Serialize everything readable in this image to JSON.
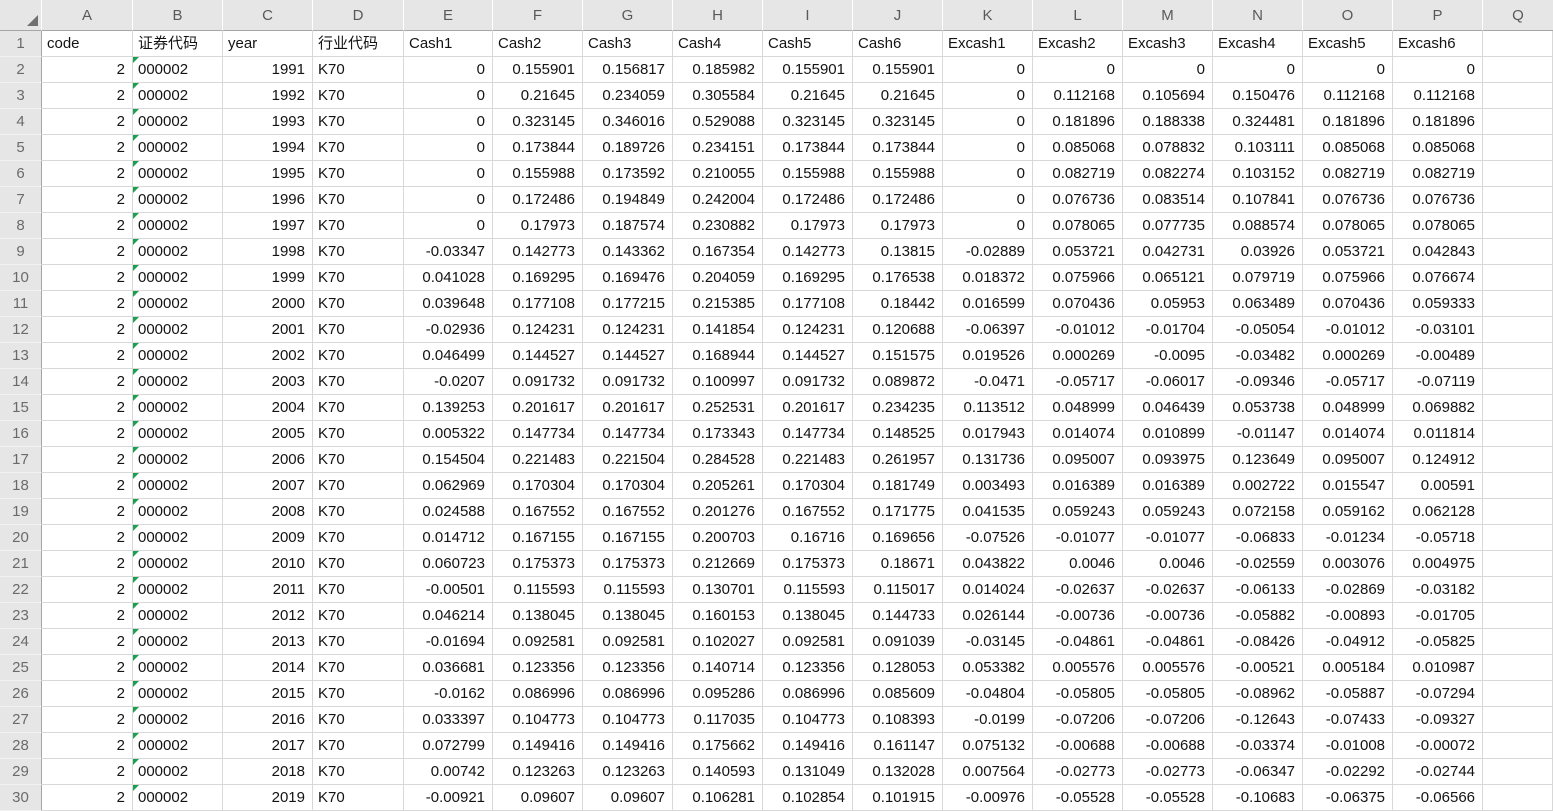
{
  "spreadsheet": {
    "corner_label": "select-all",
    "column_letters": [
      "A",
      "B",
      "C",
      "D",
      "E",
      "F",
      "G",
      "H",
      "I",
      "J",
      "K",
      "L",
      "M",
      "N",
      "O",
      "P",
      "Q"
    ],
    "field_header_row": {
      "n": "1",
      "cells": [
        "code",
        "证券代码",
        "year",
        "行业代码",
        "Cash1",
        "Cash2",
        "Cash3",
        "Cash4",
        "Cash5",
        "Cash6",
        "Excash1",
        "Excash2",
        "Excash3",
        "Excash4",
        "Excash5",
        "Excash6",
        ""
      ]
    },
    "text_column_indexes": [
      1,
      3
    ],
    "flagged_column_index": 1,
    "colors": {
      "header_background": "#e6e6e6",
      "header_text": "#595959",
      "gridline": "#d8d8d8",
      "error_flag_green": "#1e9e50",
      "cell_text": "#131313"
    },
    "rows": [
      {
        "n": "2",
        "cells": [
          "2",
          "000002",
          "1991",
          "K70",
          "0",
          "0.155901",
          "0.156817",
          "0.185982",
          "0.155901",
          "0.155901",
          "0",
          "0",
          "0",
          "0",
          "0",
          "0",
          ""
        ]
      },
      {
        "n": "3",
        "cells": [
          "2",
          "000002",
          "1992",
          "K70",
          "0",
          "0.21645",
          "0.234059",
          "0.305584",
          "0.21645",
          "0.21645",
          "0",
          "0.112168",
          "0.105694",
          "0.150476",
          "0.112168",
          "0.112168",
          ""
        ]
      },
      {
        "n": "4",
        "cells": [
          "2",
          "000002",
          "1993",
          "K70",
          "0",
          "0.323145",
          "0.346016",
          "0.529088",
          "0.323145",
          "0.323145",
          "0",
          "0.181896",
          "0.188338",
          "0.324481",
          "0.181896",
          "0.181896",
          ""
        ]
      },
      {
        "n": "5",
        "cells": [
          "2",
          "000002",
          "1994",
          "K70",
          "0",
          "0.173844",
          "0.189726",
          "0.234151",
          "0.173844",
          "0.173844",
          "0",
          "0.085068",
          "0.078832",
          "0.103111",
          "0.085068",
          "0.085068",
          ""
        ]
      },
      {
        "n": "6",
        "cells": [
          "2",
          "000002",
          "1995",
          "K70",
          "0",
          "0.155988",
          "0.173592",
          "0.210055",
          "0.155988",
          "0.155988",
          "0",
          "0.082719",
          "0.082274",
          "0.103152",
          "0.082719",
          "0.082719",
          ""
        ]
      },
      {
        "n": "7",
        "cells": [
          "2",
          "000002",
          "1996",
          "K70",
          "0",
          "0.172486",
          "0.194849",
          "0.242004",
          "0.172486",
          "0.172486",
          "0",
          "0.076736",
          "0.083514",
          "0.107841",
          "0.076736",
          "0.076736",
          ""
        ]
      },
      {
        "n": "8",
        "cells": [
          "2",
          "000002",
          "1997",
          "K70",
          "0",
          "0.17973",
          "0.187574",
          "0.230882",
          "0.17973",
          "0.17973",
          "0",
          "0.078065",
          "0.077735",
          "0.088574",
          "0.078065",
          "0.078065",
          ""
        ]
      },
      {
        "n": "9",
        "cells": [
          "2",
          "000002",
          "1998",
          "K70",
          "-0.03347",
          "0.142773",
          "0.143362",
          "0.167354",
          "0.142773",
          "0.13815",
          "-0.02889",
          "0.053721",
          "0.042731",
          "0.03926",
          "0.053721",
          "0.042843",
          ""
        ]
      },
      {
        "n": "10",
        "cells": [
          "2",
          "000002",
          "1999",
          "K70",
          "0.041028",
          "0.169295",
          "0.169476",
          "0.204059",
          "0.169295",
          "0.176538",
          "0.018372",
          "0.075966",
          "0.065121",
          "0.079719",
          "0.075966",
          "0.076674",
          ""
        ]
      },
      {
        "n": "11",
        "cells": [
          "2",
          "000002",
          "2000",
          "K70",
          "0.039648",
          "0.177108",
          "0.177215",
          "0.215385",
          "0.177108",
          "0.18442",
          "0.016599",
          "0.070436",
          "0.05953",
          "0.063489",
          "0.070436",
          "0.059333",
          ""
        ]
      },
      {
        "n": "12",
        "cells": [
          "2",
          "000002",
          "2001",
          "K70",
          "-0.02936",
          "0.124231",
          "0.124231",
          "0.141854",
          "0.124231",
          "0.120688",
          "-0.06397",
          "-0.01012",
          "-0.01704",
          "-0.05054",
          "-0.01012",
          "-0.03101",
          ""
        ]
      },
      {
        "n": "13",
        "cells": [
          "2",
          "000002",
          "2002",
          "K70",
          "0.046499",
          "0.144527",
          "0.144527",
          "0.168944",
          "0.144527",
          "0.151575",
          "0.019526",
          "0.000269",
          "-0.0095",
          "-0.03482",
          "0.000269",
          "-0.00489",
          ""
        ]
      },
      {
        "n": "14",
        "cells": [
          "2",
          "000002",
          "2003",
          "K70",
          "-0.0207",
          "0.091732",
          "0.091732",
          "0.100997",
          "0.091732",
          "0.089872",
          "-0.0471",
          "-0.05717",
          "-0.06017",
          "-0.09346",
          "-0.05717",
          "-0.07119",
          ""
        ]
      },
      {
        "n": "15",
        "cells": [
          "2",
          "000002",
          "2004",
          "K70",
          "0.139253",
          "0.201617",
          "0.201617",
          "0.252531",
          "0.201617",
          "0.234235",
          "0.113512",
          "0.048999",
          "0.046439",
          "0.053738",
          "0.048999",
          "0.069882",
          ""
        ]
      },
      {
        "n": "16",
        "cells": [
          "2",
          "000002",
          "2005",
          "K70",
          "0.005322",
          "0.147734",
          "0.147734",
          "0.173343",
          "0.147734",
          "0.148525",
          "0.017943",
          "0.014074",
          "0.010899",
          "-0.01147",
          "0.014074",
          "0.011814",
          ""
        ]
      },
      {
        "n": "17",
        "cells": [
          "2",
          "000002",
          "2006",
          "K70",
          "0.154504",
          "0.221483",
          "0.221504",
          "0.284528",
          "0.221483",
          "0.261957",
          "0.131736",
          "0.095007",
          "0.093975",
          "0.123649",
          "0.095007",
          "0.124912",
          ""
        ]
      },
      {
        "n": "18",
        "cells": [
          "2",
          "000002",
          "2007",
          "K70",
          "0.062969",
          "0.170304",
          "0.170304",
          "0.205261",
          "0.170304",
          "0.181749",
          "0.003493",
          "0.016389",
          "0.016389",
          "0.002722",
          "0.015547",
          "0.00591",
          ""
        ]
      },
      {
        "n": "19",
        "cells": [
          "2",
          "000002",
          "2008",
          "K70",
          "0.024588",
          "0.167552",
          "0.167552",
          "0.201276",
          "0.167552",
          "0.171775",
          "0.041535",
          "0.059243",
          "0.059243",
          "0.072158",
          "0.059162",
          "0.062128",
          ""
        ]
      },
      {
        "n": "20",
        "cells": [
          "2",
          "000002",
          "2009",
          "K70",
          "0.014712",
          "0.167155",
          "0.167155",
          "0.200703",
          "0.16716",
          "0.169656",
          "-0.07526",
          "-0.01077",
          "-0.01077",
          "-0.06833",
          "-0.01234",
          "-0.05718",
          ""
        ]
      },
      {
        "n": "21",
        "cells": [
          "2",
          "000002",
          "2010",
          "K70",
          "0.060723",
          "0.175373",
          "0.175373",
          "0.212669",
          "0.175373",
          "0.18671",
          "0.043822",
          "0.0046",
          "0.0046",
          "-0.02559",
          "0.003076",
          "0.004975",
          ""
        ]
      },
      {
        "n": "22",
        "cells": [
          "2",
          "000002",
          "2011",
          "K70",
          "-0.00501",
          "0.115593",
          "0.115593",
          "0.130701",
          "0.115593",
          "0.115017",
          "0.014024",
          "-0.02637",
          "-0.02637",
          "-0.06133",
          "-0.02869",
          "-0.03182",
          ""
        ]
      },
      {
        "n": "23",
        "cells": [
          "2",
          "000002",
          "2012",
          "K70",
          "0.046214",
          "0.138045",
          "0.138045",
          "0.160153",
          "0.138045",
          "0.144733",
          "0.026144",
          "-0.00736",
          "-0.00736",
          "-0.05882",
          "-0.00893",
          "-0.01705",
          ""
        ]
      },
      {
        "n": "24",
        "cells": [
          "2",
          "000002",
          "2013",
          "K70",
          "-0.01694",
          "0.092581",
          "0.092581",
          "0.102027",
          "0.092581",
          "0.091039",
          "-0.03145",
          "-0.04861",
          "-0.04861",
          "-0.08426",
          "-0.04912",
          "-0.05825",
          ""
        ]
      },
      {
        "n": "25",
        "cells": [
          "2",
          "000002",
          "2014",
          "K70",
          "0.036681",
          "0.123356",
          "0.123356",
          "0.140714",
          "0.123356",
          "0.128053",
          "0.053382",
          "0.005576",
          "0.005576",
          "-0.00521",
          "0.005184",
          "0.010987",
          ""
        ]
      },
      {
        "n": "26",
        "cells": [
          "2",
          "000002",
          "2015",
          "K70",
          "-0.0162",
          "0.086996",
          "0.086996",
          "0.095286",
          "0.086996",
          "0.085609",
          "-0.04804",
          "-0.05805",
          "-0.05805",
          "-0.08962",
          "-0.05887",
          "-0.07294",
          ""
        ]
      },
      {
        "n": "27",
        "cells": [
          "2",
          "000002",
          "2016",
          "K70",
          "0.033397",
          "0.104773",
          "0.104773",
          "0.117035",
          "0.104773",
          "0.108393",
          "-0.0199",
          "-0.07206",
          "-0.07206",
          "-0.12643",
          "-0.07433",
          "-0.09327",
          ""
        ]
      },
      {
        "n": "28",
        "cells": [
          "2",
          "000002",
          "2017",
          "K70",
          "0.072799",
          "0.149416",
          "0.149416",
          "0.175662",
          "0.149416",
          "0.161147",
          "0.075132",
          "-0.00688",
          "-0.00688",
          "-0.03374",
          "-0.01008",
          "-0.00072",
          ""
        ]
      },
      {
        "n": "29",
        "cells": [
          "2",
          "000002",
          "2018",
          "K70",
          "0.00742",
          "0.123263",
          "0.123263",
          "0.140593",
          "0.131049",
          "0.132028",
          "0.007564",
          "-0.02773",
          "-0.02773",
          "-0.06347",
          "-0.02292",
          "-0.02744",
          ""
        ]
      },
      {
        "n": "30",
        "cells": [
          "2",
          "000002",
          "2019",
          "K70",
          "-0.00921",
          "0.09607",
          "0.09607",
          "0.106281",
          "0.102854",
          "0.101915",
          "-0.00976",
          "-0.05528",
          "-0.05528",
          "-0.10683",
          "-0.06375",
          "-0.06566",
          ""
        ]
      }
    ]
  }
}
